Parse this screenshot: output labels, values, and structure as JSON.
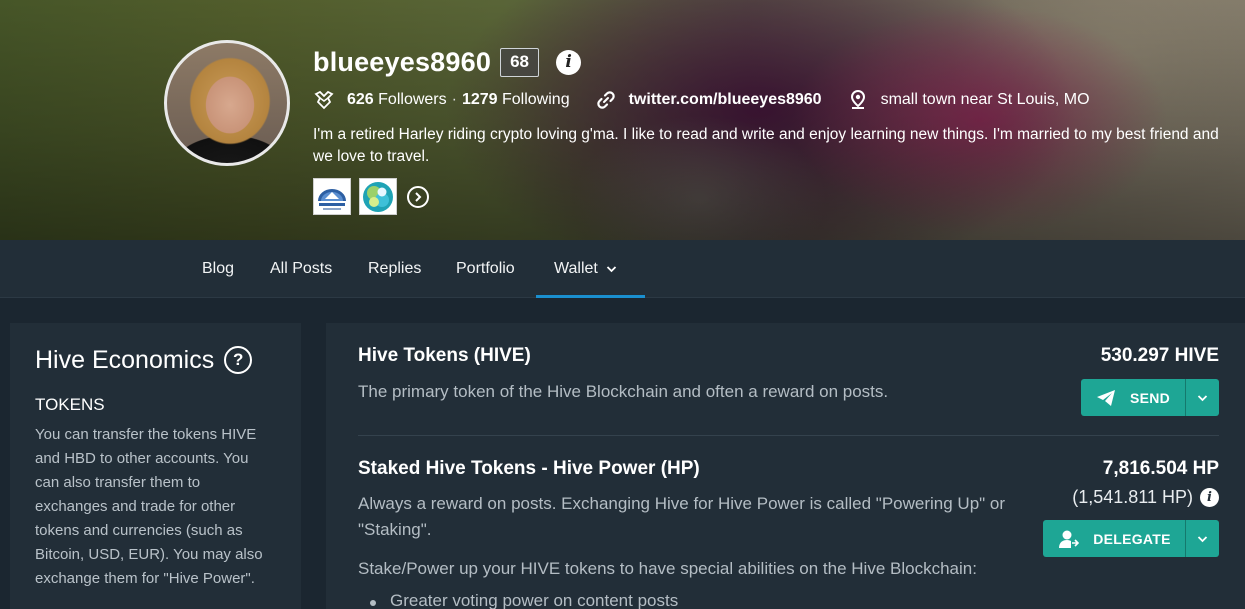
{
  "profile": {
    "username": "blueeyes8960",
    "reputation": "68",
    "followers_count": "626",
    "followers_label": "Followers",
    "separator": "·",
    "following_count": "1279",
    "following_label": "Following",
    "website": "twitter.com/blueeyes8960",
    "location": "small town near St Louis, MO",
    "bio": "I'm a retired Harley riding crypto loving g'ma. I like to read and write and enjoy learning new things. I'm married to my best friend and we love to travel."
  },
  "tabs": [
    {
      "label": "Blog"
    },
    {
      "label": "All Posts"
    },
    {
      "label": "Replies"
    },
    {
      "label": "Portfolio"
    },
    {
      "label": "Wallet",
      "active": true
    }
  ],
  "sidebar": {
    "title": "Hive Economics",
    "subtitle": "TOKENS",
    "text": "You can transfer the tokens HIVE and HBD to other accounts. You can also transfer them to exchanges and trade for other tokens and currencies (such as Bitcoin, USD, EUR). You may also exchange them for \"Hive Power\"."
  },
  "wallet": {
    "hive": {
      "title": "Hive Tokens (HIVE)",
      "description": "The primary token of the Hive Blockchain and often a reward on posts.",
      "amount": "530.297 HIVE",
      "action_label": "SEND"
    },
    "hp": {
      "title": "Staked Hive Tokens - Hive Power (HP)",
      "description": "Always a reward on posts. Exchanging Hive for Hive Power is called \"Powering Up\" or \"Staking\".",
      "amount": "7,816.504 HP",
      "delegated": "(1,541.811 HP)",
      "action_label": "DELEGATE",
      "stake_intro": "Stake/Power up your HIVE tokens to have special abilities on the Hive Blockchain:",
      "bullets": [
        "Greater voting power on content posts"
      ]
    }
  },
  "colors": {
    "accent_tab": "#1a8fcf",
    "button": "#1ea695",
    "panel": "#222e38",
    "background": "#1b2630"
  }
}
